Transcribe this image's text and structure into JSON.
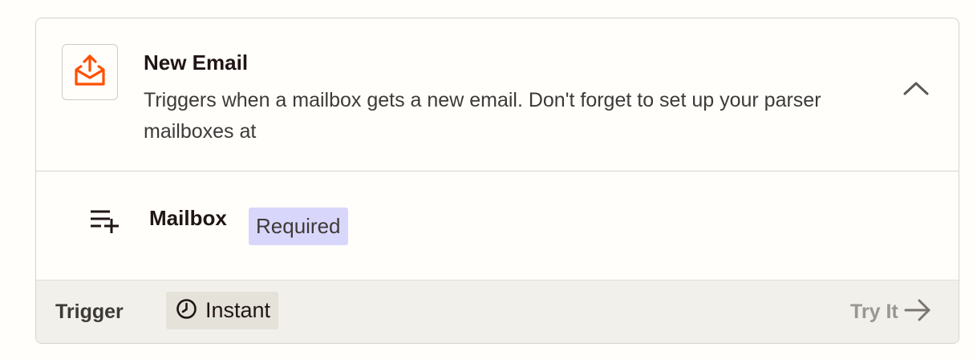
{
  "trigger_card": {
    "app_icon": "email-upload-icon",
    "title": "New Email",
    "description": "Triggers when a mailbox gets a new email. Don't forget to set up your parser mailboxes at",
    "collapse_icon": "chevron-up-icon"
  },
  "field": {
    "icon": "list-add-icon",
    "label": "Mailbox",
    "badge": "Required"
  },
  "footer": {
    "type_label": "Trigger",
    "badge_icon": "clock-icon",
    "badge_label": "Instant",
    "try_it_label": "Try It",
    "try_it_icon": "arrow-right-icon"
  },
  "colors": {
    "brand_accent": "#ff4f00",
    "required_badge_bg": "#d9d6fb",
    "footer_bg": "#f2f0eb"
  }
}
